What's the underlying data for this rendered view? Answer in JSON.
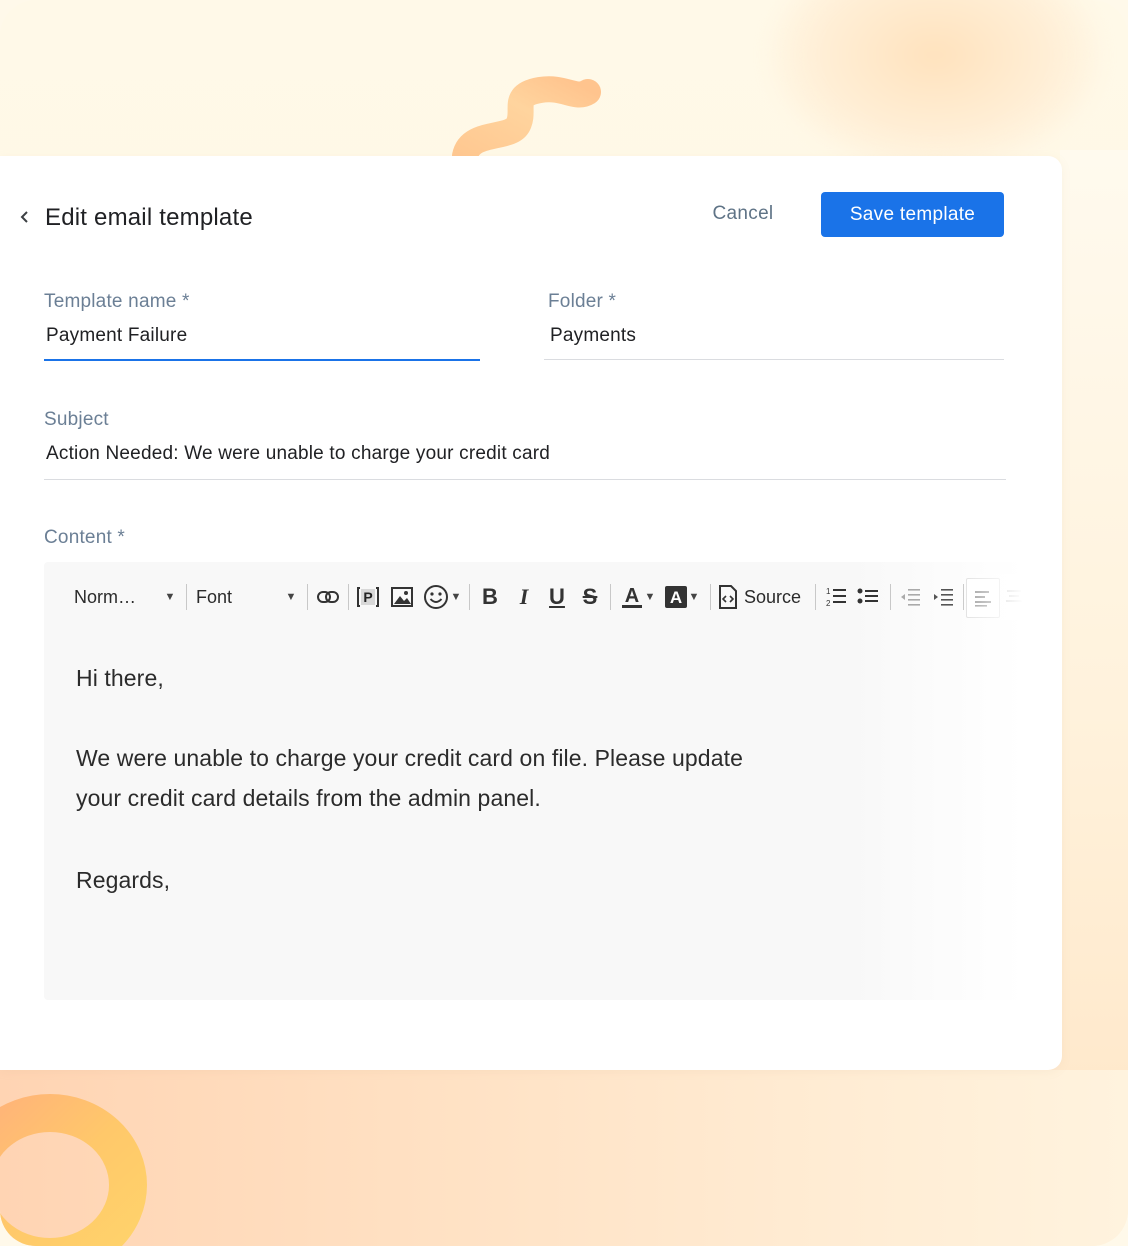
{
  "header": {
    "back_icon": "chevron-left-icon",
    "title": "Edit email template",
    "cancel_label": "Cancel",
    "save_label": "Save template"
  },
  "form": {
    "template_name": {
      "label": "Template name *",
      "value": "Payment Failure"
    },
    "folder": {
      "label": "Folder *",
      "value": "Payments"
    },
    "subject": {
      "label": "Subject",
      "value": "Action Needed: We were unable to charge your credit card"
    },
    "content_label": "Content *"
  },
  "toolbar": {
    "format_select": "Norm…",
    "font_select": "Font",
    "source_label": "Source",
    "icons": [
      "link-icon",
      "placeholder-icon",
      "image-icon",
      "emoji-icon",
      "bold-icon",
      "italic-icon",
      "underline-icon",
      "strikethrough-icon",
      "text-color-icon",
      "background-color-icon",
      "source-icon",
      "numbered-list-icon",
      "bulleted-list-icon",
      "decrease-indent-icon",
      "increase-indent-icon",
      "align-left-icon",
      "align-center-icon"
    ]
  },
  "content": {
    "greeting": "Hi there,",
    "paragraph_line_1": "We were unable to charge your credit card on file. Please update",
    "paragraph_line_2": "your credit card details from the admin panel.",
    "closing": "Regards,"
  },
  "colors": {
    "primary": "#1a73e8",
    "label": "#6b7f95",
    "text": "#202124"
  }
}
